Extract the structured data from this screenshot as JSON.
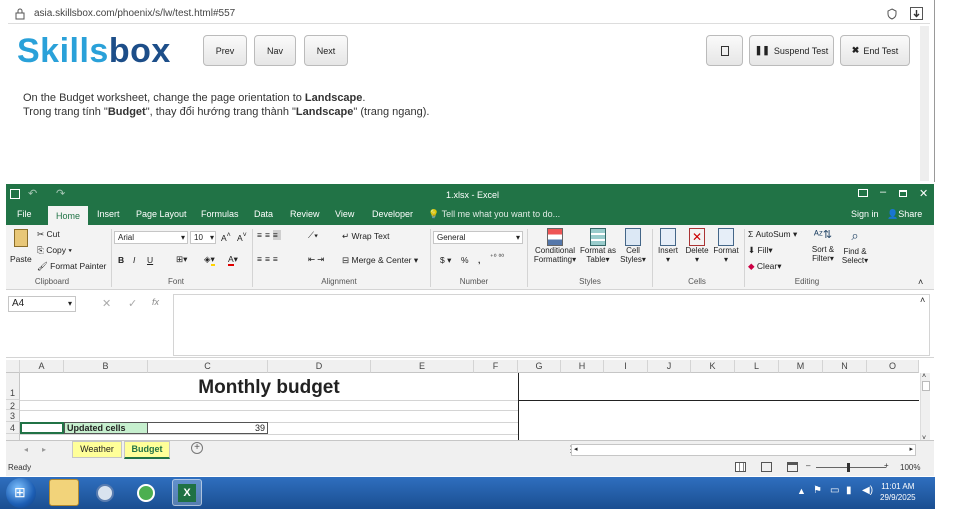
{
  "browser": {
    "url": "asia.skillsbox.com/phoenix/s/lw/test.html#557"
  },
  "header": {
    "logo_a": "Skills",
    "logo_b": "box",
    "prev": "Prev",
    "nav": "Nav",
    "next": "Next",
    "suspend": "Suspend Test",
    "end": "End Test"
  },
  "instruction": {
    "line1_pre": "On the Budget worksheet, change the page orientation to ",
    "line1_bold": "Landscape",
    "line1_post": ".",
    "line2_a": "Trong trang tính \"",
    "line2_b": "Budget",
    "line2_c": "\", thay đổi hướng trang thành \"",
    "line2_d": "Landscape",
    "line2_e": "\" (trang ngang)."
  },
  "excel": {
    "title": "1.xlsx - Excel",
    "tabs": [
      "File",
      "Home",
      "Insert",
      "Page Layout",
      "Formulas",
      "Data",
      "Review",
      "View",
      "Developer"
    ],
    "tell_me": "Tell me what you want to do...",
    "sign_in": "Sign in",
    "share": "Share",
    "clipboard": {
      "paste": "Paste",
      "cut": "Cut",
      "copy": "Copy",
      "format_painter": "Format Painter",
      "label": "Clipboard"
    },
    "font": {
      "name": "Arial",
      "size": "10",
      "label": "Font",
      "bold": "B",
      "italic": "I",
      "underline": "U"
    },
    "alignment": {
      "wrap": "Wrap Text",
      "merge": "Merge & Center",
      "label": "Alignment"
    },
    "number": {
      "format": "General",
      "currency": "$",
      "percent": "%",
      "comma": ",",
      "label": "Number"
    },
    "styles": {
      "cond1": "Conditional",
      "cond2": "Formatting",
      "fat1": "Format as",
      "fat2": "Table",
      "cell1": "Cell",
      "cell2": "Styles",
      "label": "Styles"
    },
    "cells": {
      "insert": "Insert",
      "delete": "Delete",
      "format": "Format",
      "label": "Cells"
    },
    "editing": {
      "autosum": "AutoSum",
      "fill": "Fill",
      "clear": "Clear",
      "sort1": "Sort &",
      "sort2": "Filter",
      "find1": "Find &",
      "find2": "Select",
      "label": "Editing"
    },
    "name_box": "A4",
    "columns": [
      "A",
      "B",
      "C",
      "D",
      "E",
      "F",
      "G",
      "H",
      "I",
      "J",
      "K",
      "L",
      "M",
      "N",
      "O"
    ],
    "rows": [
      "1",
      "2",
      "3",
      "4"
    ],
    "cells_data": {
      "title": "Monthly budget",
      "label": "Updated cells",
      "value": "39"
    },
    "sheets": [
      "Weather",
      "Budget"
    ],
    "status": {
      "ready": "Ready",
      "zoom": "100%"
    }
  },
  "taskbar": {
    "time": "11:01 AM",
    "date": "29/9/2025"
  }
}
